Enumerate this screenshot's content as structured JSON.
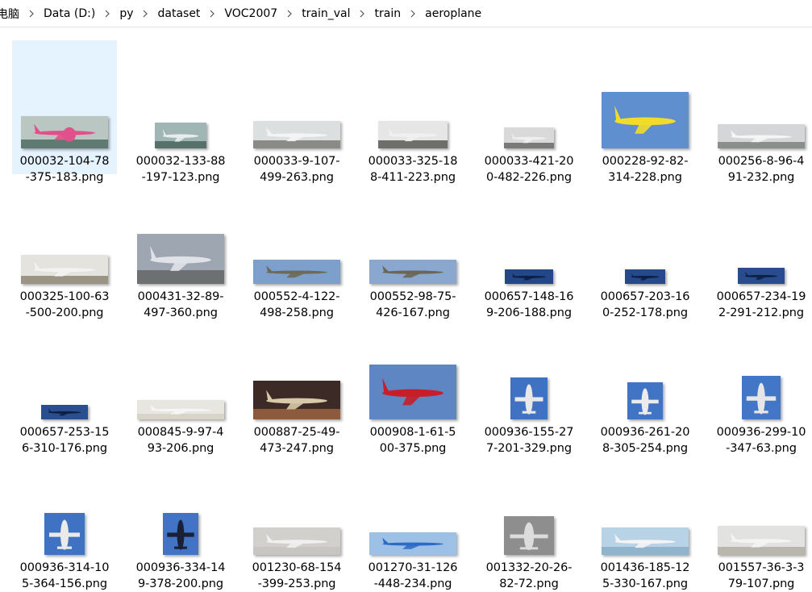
{
  "breadcrumb": [
    {
      "label": "电脑"
    },
    {
      "label": "Data (D:)"
    },
    {
      "label": "py"
    },
    {
      "label": "dataset"
    },
    {
      "label": "VOC2007"
    },
    {
      "label": "train_val"
    },
    {
      "label": "train"
    },
    {
      "label": "aeroplane"
    }
  ],
  "files": [
    {
      "l1": "000032-104-78",
      "l2": "-375-183.png",
      "sky": "#b9c6c2",
      "ground": "#5f7a70",
      "plane": "#e0508a",
      "selected": true
    },
    {
      "l1": "000032-133-88",
      "l2": "-197-123.png",
      "sky": "#9fb6b4",
      "ground": "#56706a",
      "plane": "#e8ecec"
    },
    {
      "l1": "000033-9-107-",
      "l2": "499-263.png",
      "sky": "#dcdfe0",
      "ground": "#8a8a86",
      "plane": "#f4f4f4"
    },
    {
      "l1": "000033-325-18",
      "l2": "8-411-223.png",
      "sky": "#e6e6e6",
      "ground": "#6e6e6a",
      "plane": "#f0f0f0"
    },
    {
      "l1": "000033-421-20",
      "l2": "0-482-226.png",
      "sky": "#d9d9d9",
      "ground": "#7a7a78",
      "plane": "#eeeeee"
    },
    {
      "l1": "000228-92-82-",
      "l2": "314-228.png",
      "sky": "#5f8fce",
      "ground": "#5f8fce",
      "plane": "#f1dc2a"
    },
    {
      "l1": "000256-8-96-4",
      "l2": "91-232.png",
      "sky": "#d4d6d8",
      "ground": "#8a8f8c",
      "plane": "#f5f5f5"
    },
    {
      "l1": "000325-100-63",
      "l2": "-500-200.png",
      "sky": "#e4e3de",
      "ground": "#9b9484",
      "plane": "#f2f2f2"
    },
    {
      "l1": "000431-32-89-",
      "l2": "497-360.png",
      "sky": "#9ea6b2",
      "ground": "#6c7070",
      "plane": "#dfe2e8"
    },
    {
      "l1": "000552-4-122-",
      "l2": "498-258.png",
      "sky": "#7d9fcb",
      "ground": "#7d9fcb",
      "plane": "#6e6a58"
    },
    {
      "l1": "000552-98-75-",
      "l2": "426-167.png",
      "sky": "#8aa7cf",
      "ground": "#8aa7cf",
      "plane": "#6b6655"
    },
    {
      "l1": "000657-148-16",
      "l2": "9-206-188.png",
      "sky": "#24478a",
      "ground": "#24478a",
      "plane": "#0c1f44"
    },
    {
      "l1": "000657-203-16",
      "l2": "0-252-178.png",
      "sky": "#26498c",
      "ground": "#26498c",
      "plane": "#0c1f44"
    },
    {
      "l1": "000657-234-19",
      "l2": "2-291-212.png",
      "sky": "#284c8e",
      "ground": "#284c8e",
      "plane": "#0c1f44"
    },
    {
      "l1": "000657-253-15",
      "l2": "6-310-176.png",
      "sky": "#2a4e90",
      "ground": "#2a4e90",
      "plane": "#0c1f44"
    },
    {
      "l1": "000845-9-97-4",
      "l2": "93-206.png",
      "sky": "#e8e6e0",
      "ground": "#d9d4c8",
      "plane": "#f6f6f6"
    },
    {
      "l1": "000887-25-49-",
      "l2": "473-247.png",
      "sky": "#3b2a26",
      "ground": "#8c5a3c",
      "plane": "#d8c9a8"
    },
    {
      "l1": "000908-1-61-5",
      "l2": "00-375.png",
      "sky": "#5d86c2",
      "ground": "#5d86c2",
      "plane": "#c81e2a"
    },
    {
      "l1": "000936-155-27",
      "l2": "7-201-329.png",
      "sky": "#3f72c2",
      "ground": "#3f72c2",
      "plane": "#e9e9e9"
    },
    {
      "l1": "000936-261-20",
      "l2": "8-305-254.png",
      "sky": "#4174c4",
      "ground": "#4174c4",
      "plane": "#ececec"
    },
    {
      "l1": "000936-299-10",
      "l2": "-347-63.png",
      "sky": "#4376c6",
      "ground": "#4376c6",
      "plane": "#e6e6e6"
    },
    {
      "l1": "000936-314-10",
      "l2": "5-364-156.png",
      "sky": "#3f72c2",
      "ground": "#3f72c2",
      "plane": "#eaeaea"
    },
    {
      "l1": "000936-334-14",
      "l2": "9-378-200.png",
      "sky": "#4174c4",
      "ground": "#4174c4",
      "plane": "#1a2036"
    },
    {
      "l1": "001230-68-154",
      "l2": "-399-253.png",
      "sky": "#d2d0cc",
      "ground": "#c8c6c2",
      "plane": "#f0f0f0"
    },
    {
      "l1": "001270-31-126",
      "l2": "-448-234.png",
      "sky": "#9cc0e6",
      "ground": "#9cc0e6",
      "plane": "#2f6bc4"
    },
    {
      "l1": "001332-20-26-",
      "l2": "82-72.png",
      "sky": "#8e8e8e",
      "ground": "#8e8e8e",
      "plane": "#dcdcdc"
    },
    {
      "l1": "001436-185-12",
      "l2": "5-330-167.png",
      "sky": "#b8d2e6",
      "ground": "#8fb4cc",
      "plane": "#f4f4f4"
    },
    {
      "l1": "001557-36-3-3",
      "l2": "79-107.png",
      "sky": "#e2e2e0",
      "ground": "#b9b6ae",
      "plane": "#f4f4f4"
    }
  ]
}
